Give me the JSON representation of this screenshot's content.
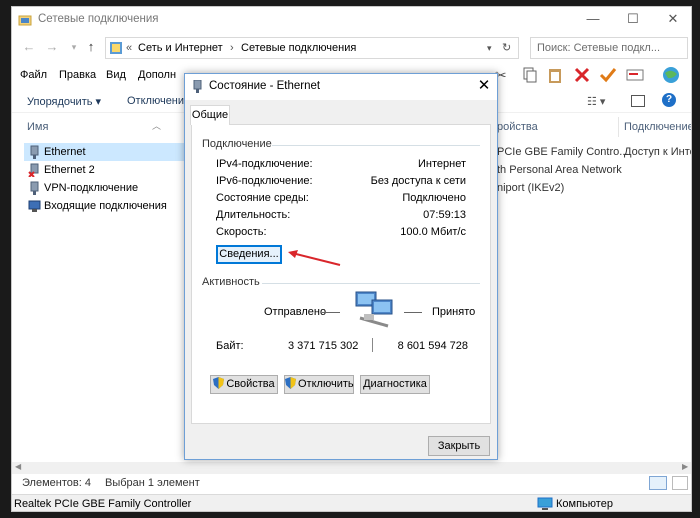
{
  "explorer": {
    "title": "Сетевые подключения",
    "breadcrumb_prefix": "«",
    "breadcrumb_1": "Сеть и Интернет",
    "breadcrumb_sep": "›",
    "breadcrumb_2": "Сетевые подключения",
    "search_placeholder": "Поиск: Сетевые подкл...",
    "menu": [
      "Файл",
      "Правка",
      "Вид",
      "Дополн"
    ],
    "cmd_organize": "Упорядочить ▾",
    "cmd_disable": "Отключени",
    "col_name": "Имя",
    "col_devname": "ройства",
    "col_connect": "Подключение",
    "items": [
      {
        "label": "Ethernet",
        "icon": "ethernet-icon",
        "selected": true
      },
      {
        "label": "Ethernet 2",
        "icon": "ethernet-disconnected-icon",
        "selected": false
      },
      {
        "label": "VPN-подключение",
        "icon": "vpn-icon",
        "selected": false
      },
      {
        "label": "Входящие подключения",
        "icon": "incoming-connections-icon",
        "selected": false
      }
    ],
    "dev_row1": "PCIe GBE Family Contro...",
    "conn_row1": "Доступ к Инте",
    "dev_row2": "th Personal Area Network",
    "dev_row3": "niport (IKEv2)",
    "status_items": "Элементов: 4",
    "status_selected": "Выбран 1 элемент",
    "bottom_device": "Realtek PCIe GBE Family Controller",
    "bottom_computer": "Компьютер"
  },
  "dialog": {
    "title": "Состояние - Ethernet",
    "tab": "Общие",
    "group_connection": "Подключение",
    "rows": [
      {
        "label": "IPv4-подключение:",
        "value": "Интернет"
      },
      {
        "label": "IPv6-подключение:",
        "value": "Без доступа к сети"
      },
      {
        "label": "Состояние среды:",
        "value": "Подключено"
      },
      {
        "label": "Длительность:",
        "value": "07:59:13"
      },
      {
        "label": "Скорость:",
        "value": "100.0 Мбит/с"
      }
    ],
    "details_button": "Сведения...",
    "group_activity": "Активность",
    "sent_label": "Отправлено",
    "received_label": "Принято",
    "bytes_label": "Байт:",
    "bytes_sent": "3 371 715 302",
    "bytes_received": "8 601 594 728",
    "properties_button": "Свойства",
    "disable_button": "Отключить",
    "diagnose_button": "Диагностика",
    "close_button": "Закрыть"
  },
  "colors": {
    "accent": "#0078d7",
    "arrow": "#d9262b",
    "selection": "#cce8ff"
  }
}
